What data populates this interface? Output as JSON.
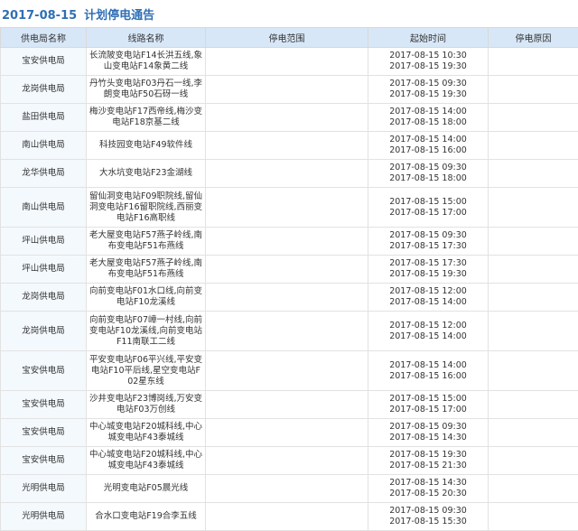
{
  "title": {
    "date": "2017-08-15",
    "text": "计划停电通告"
  },
  "headers": [
    "供电局名称",
    "线路名称",
    "停电范围",
    "起始时间",
    "停电原因"
  ],
  "rows": [
    {
      "bureau": "宝安供电局",
      "line": "长流陂变电站F14长洪五线,象山变电站F14象黄二线",
      "start": "2017-08-15 10:30",
      "end": "2017-08-15 19:30",
      "h": 31
    },
    {
      "bureau": "龙岗供电局",
      "line": "丹竹头变电站F03丹石一线,李朗变电站F50石砑一线",
      "start": "2017-08-15 09:30",
      "end": "2017-08-15 19:30",
      "h": 31
    },
    {
      "bureau": "盐田供电局",
      "line": "梅沙变电站F17西帝线,梅沙变电站F18京基二线",
      "start": "2017-08-15 14:00",
      "end": "2017-08-15 18:00",
      "h": 31
    },
    {
      "bureau": "南山供电局",
      "line": "科技园变电站F49软件线",
      "start": "2017-08-15 14:00",
      "end": "2017-08-15 16:00",
      "h": 31
    },
    {
      "bureau": "龙华供电局",
      "line": "大水坑变电站F23金湖线",
      "start": "2017-08-15 09:30",
      "end": "2017-08-15 18:00",
      "h": 31
    },
    {
      "bureau": "南山供电局",
      "line": "留仙洞变电站F09职院线,留仙洞变电站F16留职院线,西丽变电站F16高职线",
      "start": "2017-08-15 15:00",
      "end": "2017-08-15 17:00",
      "h": 44
    },
    {
      "bureau": "坪山供电局",
      "line": "老大屋变电站F57燕子岭线,南布变电站F51布燕线",
      "start": "2017-08-15 09:30",
      "end": "2017-08-15 17:30",
      "h": 31
    },
    {
      "bureau": "坪山供电局",
      "line": "老大屋变电站F57燕子岭线,南布变电站F51布燕线",
      "start": "2017-08-15 17:30",
      "end": "2017-08-15 19:30",
      "h": 31
    },
    {
      "bureau": "龙岗供电局",
      "line": "向前变电站F01水口线,向前变电站F10龙溪线",
      "start": "2017-08-15 12:00",
      "end": "2017-08-15 14:00",
      "h": 31
    },
    {
      "bureau": "龙岗供电局",
      "line": "向前变电站F07嶂一村线,向前变电站F10龙溪线,向前变电站F11南联工二线",
      "start": "2017-08-15 12:00",
      "end": "2017-08-15 14:00",
      "h": 44
    },
    {
      "bureau": "宝安供电局",
      "line": "平安变电站F06平兴线,平安变电站F10平后线,星空变电站F02星东线",
      "start": "2017-08-15 14:00",
      "end": "2017-08-15 16:00",
      "h": 44
    },
    {
      "bureau": "宝安供电局",
      "line": "沙井变电站F23博岗线,万安变电站F03万创线",
      "start": "2017-08-15 15:00",
      "end": "2017-08-15 17:00",
      "h": 31
    },
    {
      "bureau": "宝安供电局",
      "line": "中心城变电站F20城科线,中心城变电站F43泰城线",
      "start": "2017-08-15 09:30",
      "end": "2017-08-15 14:30",
      "h": 31
    },
    {
      "bureau": "宝安供电局",
      "line": "中心城变电站F20城科线,中心城变电站F43泰城线",
      "start": "2017-08-15 19:30",
      "end": "2017-08-15 21:30",
      "h": 31
    },
    {
      "bureau": "光明供电局",
      "line": "光明变电站F05晨光线",
      "start": "2017-08-15 14:30",
      "end": "2017-08-15 20:30",
      "h": 31
    },
    {
      "bureau": "光明供电局",
      "line": "合水口变电站F19合李五线",
      "start": "2017-08-15 09:30",
      "end": "2017-08-15 15:30",
      "h": 31
    }
  ]
}
